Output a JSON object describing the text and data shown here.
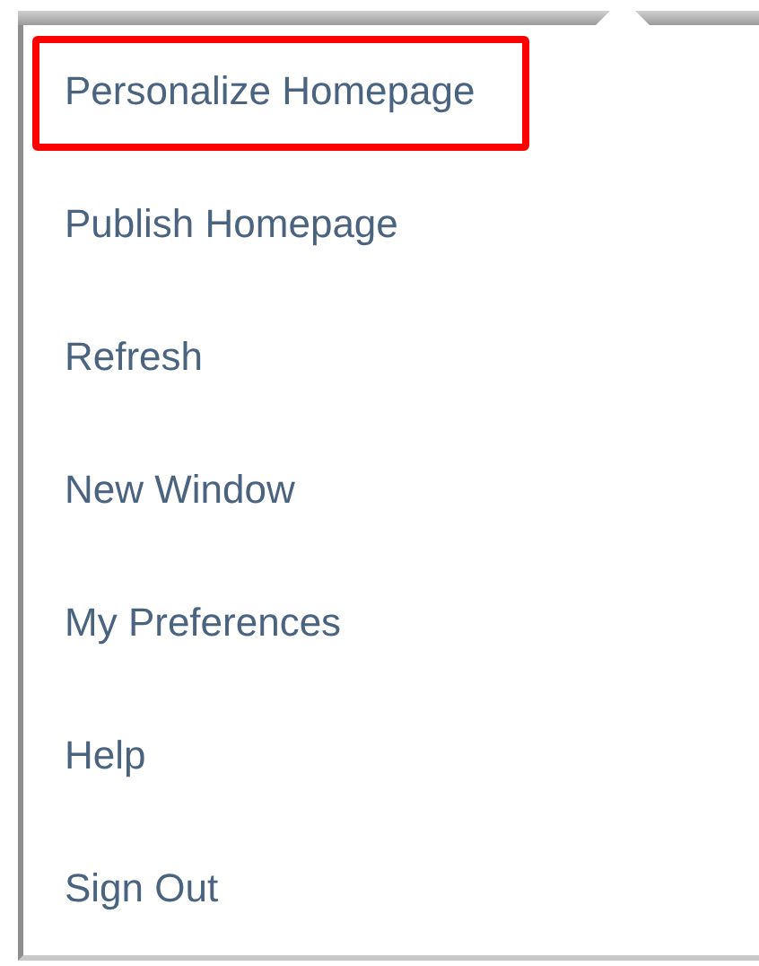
{
  "menu": {
    "items": [
      {
        "label": "Personalize Homepage",
        "highlighted": true
      },
      {
        "label": "Publish Homepage",
        "highlighted": false
      },
      {
        "label": "Refresh",
        "highlighted": false
      },
      {
        "label": "New Window",
        "highlighted": false
      },
      {
        "label": "My Preferences",
        "highlighted": false
      },
      {
        "label": "Help",
        "highlighted": false
      },
      {
        "label": "Sign Out",
        "highlighted": false
      }
    ]
  }
}
